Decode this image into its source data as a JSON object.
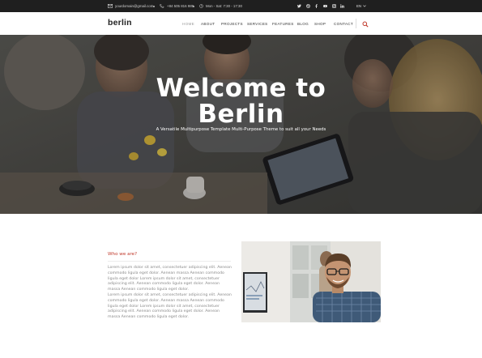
{
  "topbar": {
    "email": "yourdomain@gmail.com",
    "phone": "+84 505 816 989",
    "hours": "Mon - Sat: 7:30 - 17:30",
    "social_icons": [
      "twitter-icon",
      "dribbble-icon",
      "facebook-icon",
      "youtube-icon",
      "instagram-icon",
      "linkedin-icon"
    ],
    "language": "EN"
  },
  "nav": {
    "logo": "berlin",
    "items": [
      "HOME",
      "ABOUT",
      "PROJECTS",
      "SERVICES",
      "FEATURES",
      "BLOG",
      "SHOP",
      "CONTACT"
    ],
    "active_index": 0
  },
  "hero": {
    "title_line1": "Welcome to",
    "title_line2": "Berlin",
    "subtitle": "A Versatile Multipurpose Template Multi-Purpose Theme to suit all your Needs"
  },
  "about": {
    "heading": "Who we are?",
    "paragraph1": "Lorem ipsum dolor sit amet, consectetuer adipiscing elit. Aenean commodo ligula eget dolor. Aenean massa Aenean commodo ligula eget dolor Lorem ipsum dolor sit amet, consectetuer adipiscing elit. Aenean commodo ligula eget dolor. Aenean massa Aenean commodo ligula eget dolor.",
    "paragraph2": "Lorem ipsum dolor sit amet, consectetuer adipiscing elit. Aenean commodo ligula eget dolor. Aenean massa Aenean commodo ligula eget dolor Lorem ipsum dolor sit amet, consectetuer adipiscing elit. Aenean commodo ligula eget dolor. Aenean massa Aenean commodo ligula eget dolor."
  },
  "colors": {
    "topbar_bg": "#1f1f1f",
    "accent": "#c0392b",
    "search_icon": "#c0392b"
  }
}
